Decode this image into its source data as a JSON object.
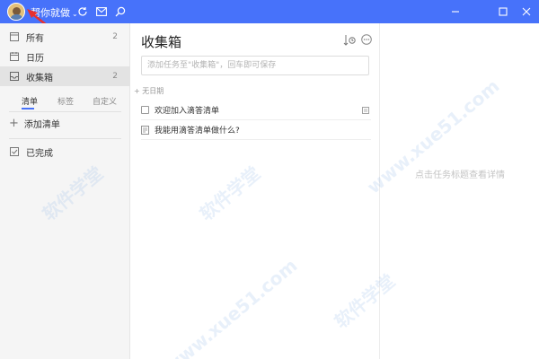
{
  "titlebar": {
    "username": "帮你就做",
    "user_menu_chevron": "chevron-down-icon",
    "icons": [
      "sync-icon",
      "mail-icon",
      "search-icon"
    ],
    "window_buttons": [
      "minimize-icon",
      "maximize-icon",
      "close-icon"
    ],
    "accent_color": "#4772fa"
  },
  "sidebar": {
    "items": [
      {
        "label": "所有",
        "count": "2",
        "icon": "all-icon"
      },
      {
        "label": "日历",
        "count": "",
        "icon": "calendar-icon"
      },
      {
        "label": "收集箱",
        "count": "2",
        "icon": "inbox-icon",
        "active": true
      }
    ],
    "tabs": [
      {
        "label": "清单",
        "active": true
      },
      {
        "label": "标签",
        "active": false
      },
      {
        "label": "自定义",
        "active": false
      }
    ],
    "add_list_label": "添加清单",
    "completed_label": "已完成"
  },
  "main": {
    "title": "收集箱",
    "add_task_placeholder": "添加任务至\"收集箱\"，回车即可保存",
    "section_header": "无日期",
    "tasks": [
      {
        "title": "欢迎加入滴答清单",
        "type": "checkbox"
      },
      {
        "title": "我能用滴答清单做什么?",
        "type": "note"
      }
    ]
  },
  "detail": {
    "empty_text": "点击任务标题查看详情"
  },
  "watermark": {
    "text": "软件学堂",
    "url": "www.xue51.com"
  }
}
